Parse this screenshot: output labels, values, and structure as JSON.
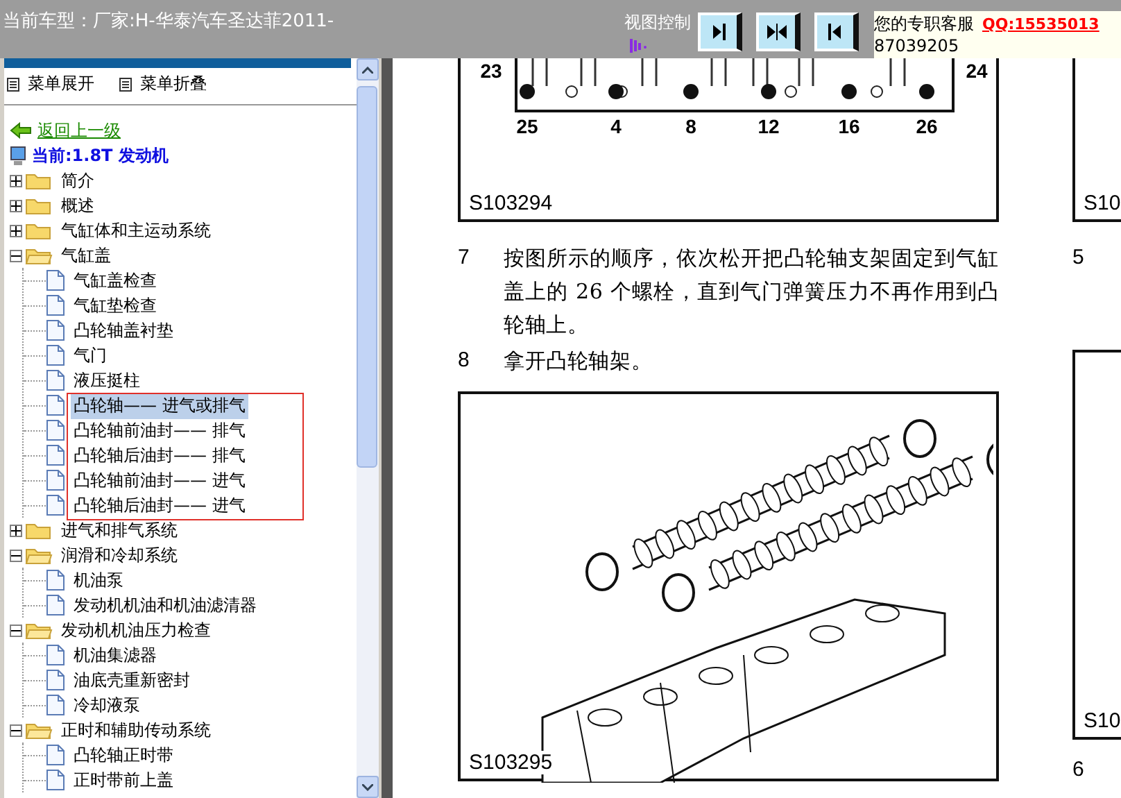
{
  "window": {
    "title": "当前车型：厂家:H-华泰汽车圣达菲2011-"
  },
  "view_control": {
    "label": "视图控制",
    "buttons": [
      {
        "kind": "right"
      },
      {
        "kind": "both"
      },
      {
        "kind": "left"
      }
    ]
  },
  "support": {
    "label": "您的专职客服",
    "qq": "QQ:15535013",
    "phone": "87039205"
  },
  "sidebar": {
    "menu": [
      "菜单展开",
      "菜单折叠"
    ],
    "back_link": "返回上一级",
    "current": "当前:1.8T 发动机",
    "tree": [
      {
        "kind": "folder",
        "label": "简介",
        "expanded": false
      },
      {
        "kind": "folder",
        "label": "概述",
        "expanded": false
      },
      {
        "kind": "folder",
        "label": "气缸体和主运动系统",
        "expanded": false
      },
      {
        "kind": "folder",
        "label": "气缸盖",
        "expanded": true,
        "children": [
          {
            "kind": "page",
            "label": "气缸盖检查",
            "selected": false,
            "boxed": false
          },
          {
            "kind": "page",
            "label": "气缸垫检查",
            "selected": false,
            "boxed": false
          },
          {
            "kind": "page",
            "label": "凸轮轴盖衬垫",
            "selected": false,
            "boxed": false
          },
          {
            "kind": "page",
            "label": "气门",
            "selected": false,
            "boxed": false
          },
          {
            "kind": "page",
            "label": "液压挺柱",
            "selected": false,
            "boxed": false
          },
          {
            "kind": "page",
            "label": "凸轮轴——  进气或排气",
            "selected": true,
            "boxed": true
          },
          {
            "kind": "page",
            "label": "凸轮轴前油封——  排气",
            "selected": false,
            "boxed": true
          },
          {
            "kind": "page",
            "label": "凸轮轴后油封——  排气",
            "selected": false,
            "boxed": true
          },
          {
            "kind": "page",
            "label": "凸轮轴前油封——  进气",
            "selected": false,
            "boxed": true
          },
          {
            "kind": "page",
            "label": "凸轮轴后油封——  进气",
            "selected": false,
            "boxed": true
          }
        ]
      },
      {
        "kind": "folder",
        "label": "进气和排气系统",
        "expanded": false
      },
      {
        "kind": "folder",
        "label": "润滑和冷却系统",
        "expanded": true,
        "children": [
          {
            "kind": "page",
            "label": "机油泵",
            "selected": false,
            "boxed": false
          },
          {
            "kind": "page",
            "label": "发动机机油和机油滤清器",
            "selected": false,
            "boxed": false
          }
        ]
      },
      {
        "kind": "folder",
        "label": "发动机机油压力检查",
        "expanded": true,
        "children": [
          {
            "kind": "page",
            "label": "机油集滤器",
            "selected": false,
            "boxed": false
          },
          {
            "kind": "page",
            "label": "油底壳重新密封",
            "selected": false,
            "boxed": false
          },
          {
            "kind": "page",
            "label": "冷却液泵",
            "selected": false,
            "boxed": false
          }
        ]
      },
      {
        "kind": "folder",
        "label": "正时和辅助传动系统",
        "expanded": true,
        "children": [
          {
            "kind": "page",
            "label": "凸轮轴正时带",
            "selected": false,
            "boxed": false
          },
          {
            "kind": "page",
            "label": "正时带前上盖",
            "selected": false,
            "boxed": false
          }
        ]
      }
    ]
  },
  "document": {
    "main_column": [
      {
        "kind": "bolt-figure",
        "caption": "S103294",
        "callouts": [
          "23",
          "24",
          "25",
          "4",
          "8",
          "12",
          "16",
          "26"
        ]
      },
      {
        "kind": "step",
        "number": "7",
        "text": "按图所示的顺序，依次松开把凸轮轴支架固定到气缸盖上的 26 个螺栓，直到气门弹簧压力不再作用到凸轮轴上。"
      },
      {
        "kind": "step",
        "number": "8",
        "text": "拿开凸轮轴架。"
      },
      {
        "kind": "camshaft-figure",
        "caption": "S103295"
      }
    ],
    "side_column": [
      {
        "kind": "cut-figure",
        "caption": "S10"
      },
      {
        "kind": "step",
        "number": "5"
      },
      {
        "kind": "cut-figure",
        "caption": "S10"
      },
      {
        "kind": "step",
        "number": "6"
      }
    ]
  }
}
